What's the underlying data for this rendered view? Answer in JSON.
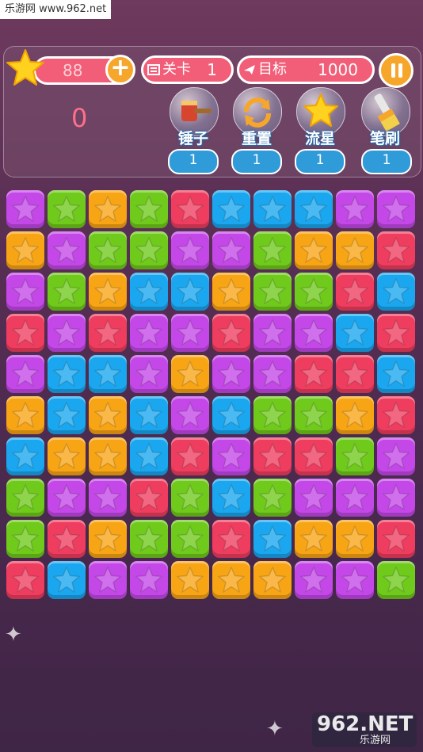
{
  "watermark_top": "乐游网 www.962.net",
  "hud": {
    "coins": "88",
    "plus": "+",
    "level_label": "关卡",
    "level_value": "1",
    "target_label": "目标",
    "target_value": "1000",
    "current_score": "0"
  },
  "tools": [
    {
      "name": "锤子",
      "count": "1",
      "icon": "hammer-icon"
    },
    {
      "name": "重置",
      "count": "1",
      "icon": "reset-icon"
    },
    {
      "name": "流星",
      "count": "1",
      "icon": "meteor-star-icon"
    },
    {
      "name": "笔刷",
      "count": "1",
      "icon": "brush-icon"
    }
  ],
  "colors": {
    "P": "#c448e8",
    "G": "#6fca1c",
    "O": "#f8a515",
    "R": "#ef3d5f",
    "B": "#1aa7ef"
  },
  "board": [
    [
      "P",
      "G",
      "O",
      "G",
      "R",
      "B",
      "B",
      "B",
      "P",
      "P"
    ],
    [
      "O",
      "P",
      "G",
      "G",
      "P",
      "P",
      "G",
      "O",
      "O",
      "R"
    ],
    [
      "P",
      "G",
      "O",
      "B",
      "B",
      "O",
      "G",
      "G",
      "R",
      "B"
    ],
    [
      "R",
      "P",
      "R",
      "P",
      "P",
      "R",
      "P",
      "P",
      "B",
      "R"
    ],
    [
      "P",
      "B",
      "B",
      "P",
      "O",
      "P",
      "P",
      "R",
      "R",
      "B"
    ],
    [
      "O",
      "B",
      "O",
      "B",
      "P",
      "B",
      "G",
      "G",
      "O",
      "R"
    ],
    [
      "B",
      "O",
      "O",
      "B",
      "R",
      "P",
      "R",
      "R",
      "G",
      "P"
    ],
    [
      "G",
      "P",
      "P",
      "R",
      "G",
      "B",
      "G",
      "P",
      "P",
      "P"
    ],
    [
      "G",
      "R",
      "O",
      "G",
      "G",
      "R",
      "B",
      "O",
      "O",
      "R"
    ],
    [
      "R",
      "B",
      "P",
      "P",
      "O",
      "O",
      "O",
      "P",
      "P",
      "G"
    ]
  ],
  "watermark_bottom": {
    "big": "962.NET",
    "small": "乐游网"
  }
}
